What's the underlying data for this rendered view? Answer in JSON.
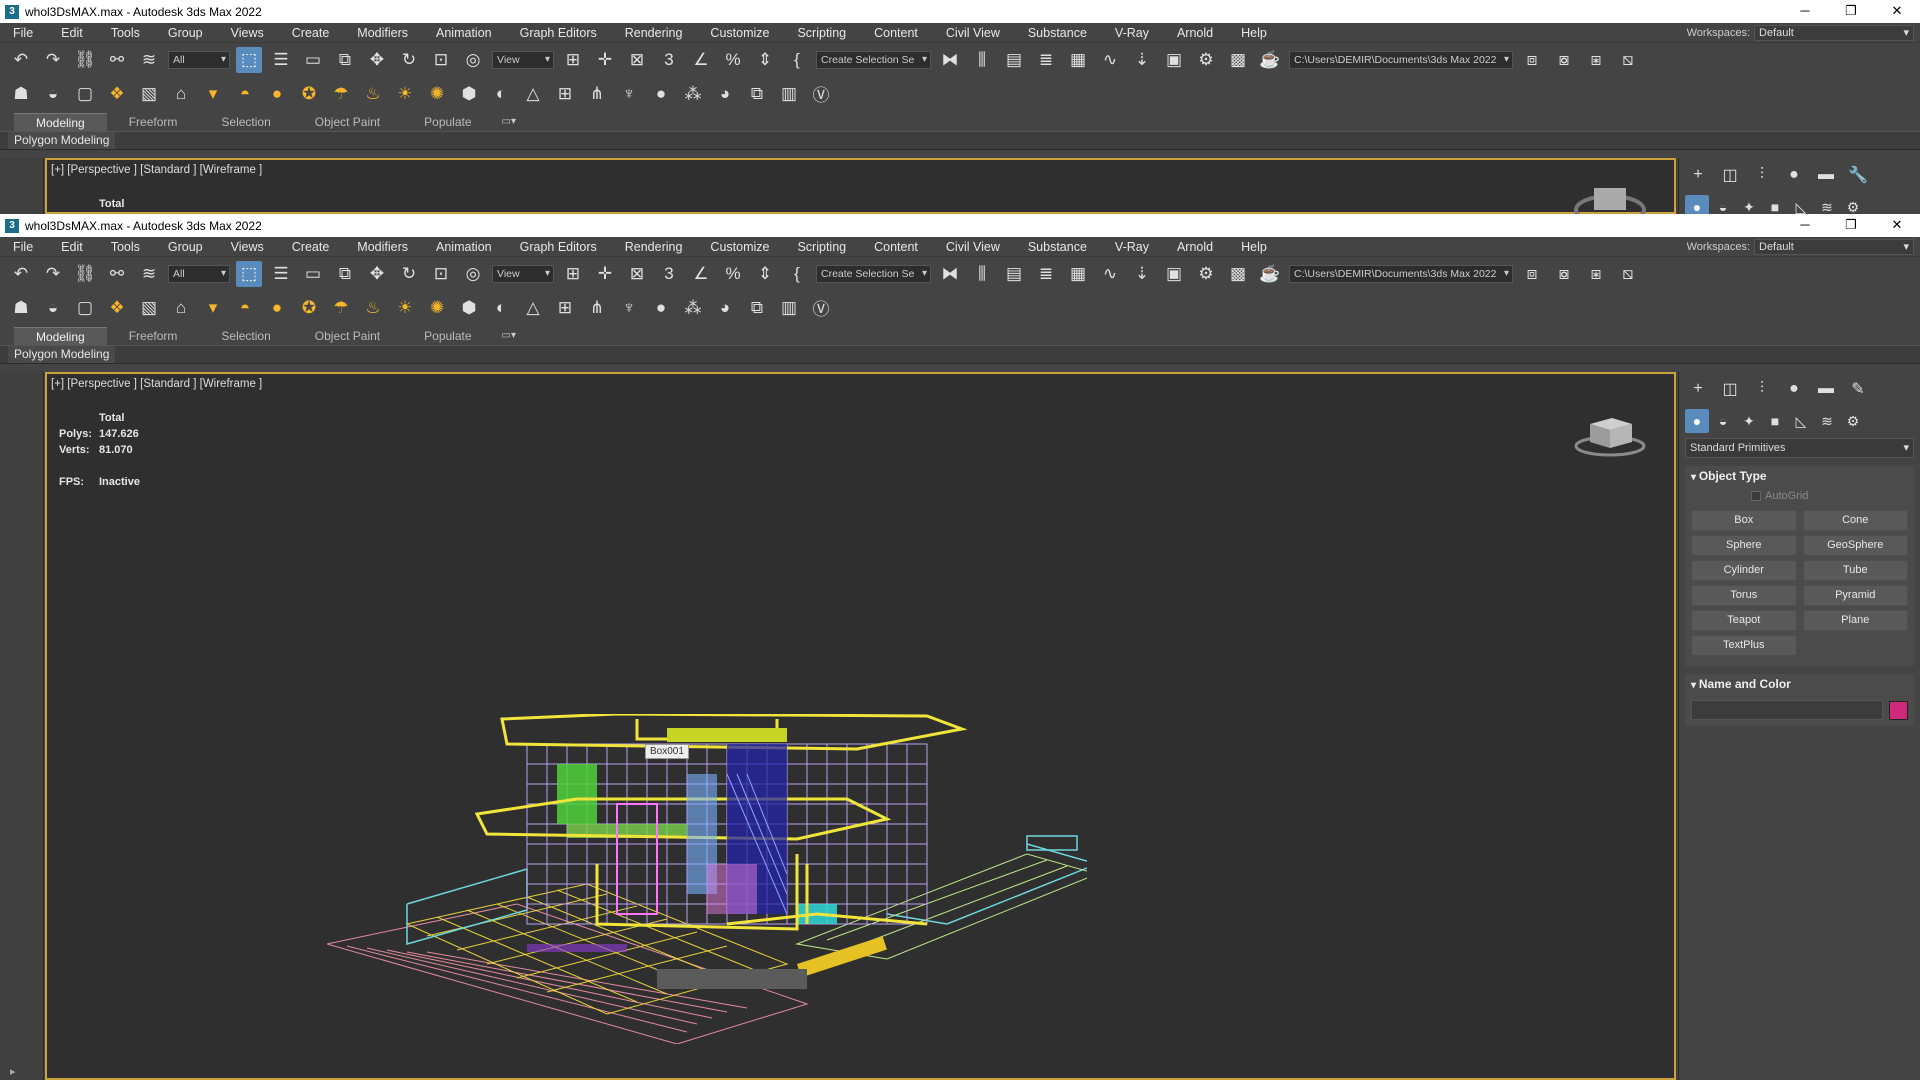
{
  "app": {
    "title": "whol3DsMAX.max - Autodesk 3ds Max 2022",
    "icon_glyph": "3",
    "controls": {
      "minimize": "─",
      "restore": "❐",
      "close": "✕"
    }
  },
  "menu": [
    "File",
    "Edit",
    "Tools",
    "Group",
    "Views",
    "Create",
    "Modifiers",
    "Animation",
    "Graph Editors",
    "Rendering",
    "Customize",
    "Scripting",
    "Content",
    "Civil View",
    "Substance",
    "V-Ray",
    "Arnold",
    "Help"
  ],
  "workspace": {
    "label": "Workspaces:",
    "value": "Default"
  },
  "toolbar": {
    "selection_filter": "All",
    "ref_coord": "View",
    "named_selection": "Create Selection Se",
    "project_path": "C:\\Users\\DEMIR\\Documents\\3ds Max 2022"
  },
  "ribbon": {
    "tabs": [
      "Modeling",
      "Freeform",
      "Selection",
      "Object Paint",
      "Populate"
    ],
    "active_tab": "Modeling",
    "panel_button": "Polygon Modeling"
  },
  "viewport": {
    "label": "[+] [Perspective ] [Standard ] [Wireframe ]",
    "stats_title": "Total",
    "polys_label": "Polys:",
    "polys_value": "147.626",
    "verts_label": "Verts:",
    "verts_value": "81.070",
    "fps_label": "FPS:",
    "fps_value": "Inactive",
    "tooltip": "Box001"
  },
  "command_panel": {
    "category": "Standard Primitives",
    "object_type_title": "Object Type",
    "autogrid_label": "AutoGrid",
    "primitives": [
      "Box",
      "Cone",
      "Sphere",
      "GeoSphere",
      "Cylinder",
      "Tube",
      "Torus",
      "Pyramid",
      "Teapot",
      "Plane",
      "TextPlus"
    ],
    "name_color_title": "Name and Color",
    "object_color": "#d0287a"
  },
  "colors": {
    "accent": "#c9a33a",
    "active_button": "#5a8bbd"
  }
}
